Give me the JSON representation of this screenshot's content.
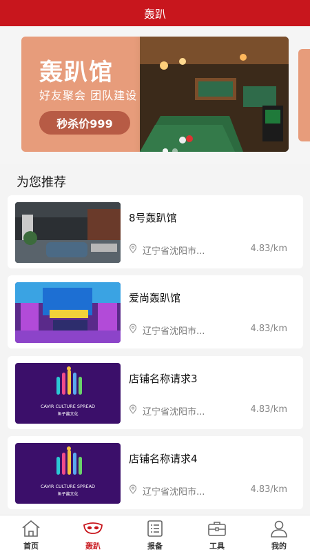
{
  "header": {
    "title": "轰趴"
  },
  "banner": {
    "title": "轰趴馆",
    "subtitle": "好友聚会 团队建设",
    "button_label": "秒杀价999"
  },
  "section": {
    "title": "为您推荐"
  },
  "venues": [
    {
      "name": "8号轰趴馆",
      "address": "辽宁省沈阳市...",
      "distance": "4.83/km",
      "thumb": "lounge-photo"
    },
    {
      "name": "爱尚轰趴馆",
      "address": "辽宁省沈阳市...",
      "distance": "4.83/km",
      "thumb": "neon-party-photo"
    },
    {
      "name": "店铺名称请求3",
      "address": "辽宁省沈阳市...",
      "distance": "4.83/km",
      "thumb": "cavir-logo",
      "logo_text": "CAVIR CULTURE SPREAD",
      "logo_cn": "鱼子酱文化"
    },
    {
      "name": "店铺名称请求4",
      "address": "辽宁省沈阳市...",
      "distance": "4.83/km",
      "thumb": "cavir-logo",
      "logo_text": "CAVIR CULTURE SPREAD",
      "logo_cn": "鱼子酱文化"
    }
  ],
  "tabbar": {
    "items": [
      {
        "label": "首页",
        "icon": "home-icon"
      },
      {
        "label": "轰趴",
        "icon": "mask-icon",
        "active": true
      },
      {
        "label": "报备",
        "icon": "list-icon"
      },
      {
        "label": "工具",
        "icon": "toolbox-icon"
      },
      {
        "label": "我的",
        "icon": "user-icon"
      }
    ]
  },
  "colors": {
    "brand": "#c8161d",
    "banner": "#e79c7b",
    "button": "#b75b45",
    "logo_bg": "#3b0f6a"
  }
}
